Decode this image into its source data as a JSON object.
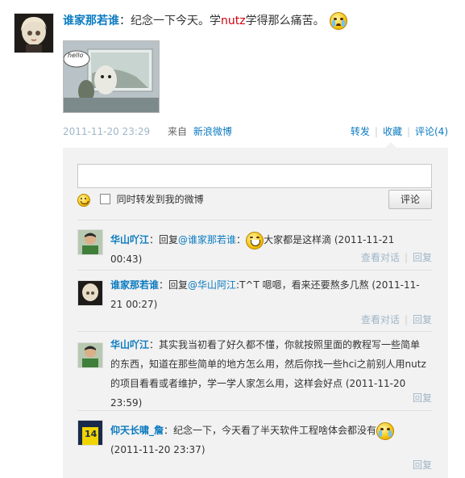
{
  "post": {
    "author": "谁家那若谁",
    "text_before": "：纪念一下今天。学",
    "highlight": "nutz",
    "text_after": "学得那么痛苦。",
    "time": "2011-11-20 23:29",
    "from_label": "来自",
    "source": "新浪微博",
    "repost_label": "转发",
    "favorite_label": "收藏",
    "comment_label": "评论(4)",
    "image_caption": "hello"
  },
  "composer": {
    "placeholder": "",
    "also_repost_label": "同时转发到我的微博",
    "submit_label": "评论"
  },
  "comments": [
    {
      "name": "华山吖江",
      "body_a": "：回复",
      "mention": "@谁家那若谁",
      "body_b": "：",
      "body_c": "大家都是这样滴 (2011-11-21 00:43)",
      "view_label": "查看对话",
      "reply_label": "回复"
    },
    {
      "name": "谁家那若谁",
      "body_a": "：回复",
      "mention": "@华山阿江",
      "body_b": ":T^T 嗯嗯，看来还要熬多几熬 (2011-11-21 00:27)",
      "view_label": "查看对话",
      "reply_label": "回复"
    },
    {
      "name": "华山吖江",
      "body_a": "：其实我当初看了好久都不懂，你就按照里面的教程写一些简单的东西，知道在那些简单的地方怎么用，然后你找一些hci之前别人用nutz的项目看看或者维护，学一学人家怎么用，这样会好点 (2011-11-20 23:59)",
      "reply_label": "回复"
    },
    {
      "name": "仰天长啸_詹",
      "body_a": "：纪念一下，今天看了半天软件工程啥体会都没有",
      "body_b": " (2011-11-20 23:37)",
      "jersey": "14",
      "reply_label": "回复"
    }
  ],
  "colors": {
    "link": "#0a7ac0",
    "highlight": "#d4000f",
    "muted": "#9fb6c8",
    "panel": "#f2f2f2"
  },
  "icons": [
    "avatar-doll",
    "laughing-emoji-icon",
    "crying-emoji-icon",
    "smiley-icon",
    "checkbox"
  ]
}
